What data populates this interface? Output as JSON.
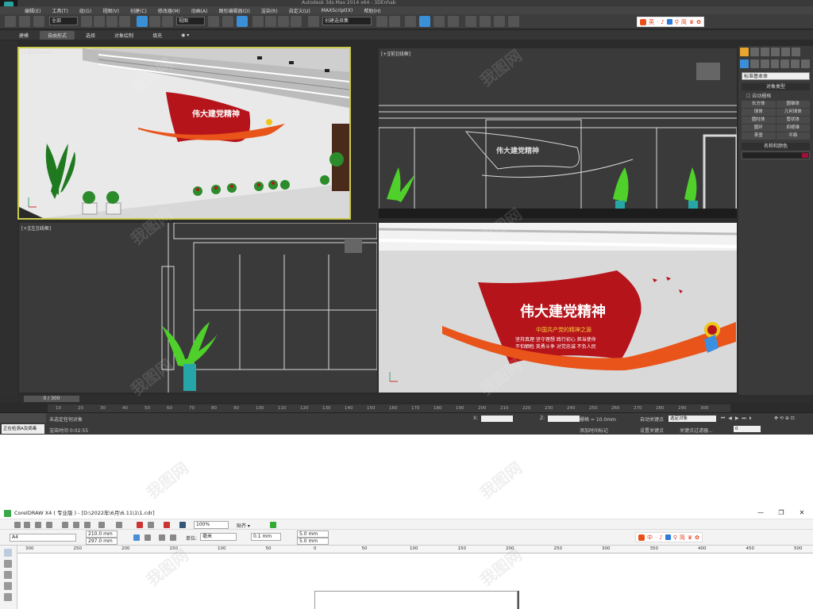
{
  "max": {
    "title": "Autodesk 3ds Max 2014 x64   -   3DEnhab",
    "menu": [
      "编辑(E)",
      "工具(T)",
      "组(G)",
      "视图(V)",
      "创建(C)",
      "修改器(M)",
      "动画(A)",
      "图形编辑器(D)",
      "渲染(R)",
      "自定义(U)",
      "MAXScript(X)",
      "帮助(H)"
    ],
    "toolbar": {
      "filter": "全部",
      "view": "视图",
      "named_selection": "创建选择集"
    },
    "ribbon_tabs": [
      "建模",
      "自由形式",
      "选择",
      "对象绘制",
      "填充"
    ],
    "ribbon_active": 1,
    "viewports": {
      "perspective": "[+][Camera]",
      "front": "[+][前][线框]",
      "left": "[+][左][线框]",
      "camera2": ""
    },
    "sign": {
      "title": "伟大建党精神",
      "subtitle": "中国共产党的精神之源",
      "lines": [
        "坚持真理  坚守理想  践行初心  担当使命",
        "不怕牺牲  英勇斗争  对党忠诚  不负人民"
      ]
    },
    "panel": {
      "category": "标准基本体",
      "section_object_type": "对象类型",
      "autogrid": "自动栅格",
      "objects": [
        "长方体",
        "圆锥体",
        "球体",
        "几何球体",
        "圆柱体",
        "管状体",
        "圆环",
        "四棱锥",
        "茶壶",
        "平面"
      ],
      "section_name_color": "名称和颜色"
    },
    "timeline": {
      "slider": "0 / 300",
      "ticks": [
        "10",
        "20",
        "30",
        "40",
        "50",
        "60",
        "70",
        "80",
        "90",
        "100",
        "110",
        "120",
        "130",
        "140",
        "150",
        "160",
        "170",
        "180",
        "190",
        "200",
        "210",
        "220",
        "230",
        "240",
        "250",
        "260",
        "270",
        "280",
        "290",
        "300"
      ]
    },
    "status": {
      "selected": "未选定任何对象",
      "render_time": "渲染时间 0:02:55",
      "warn": "正在检测A及病毒",
      "x_label": "X:",
      "z_label": "Z:",
      "grid": "栅格 = 10.0mm",
      "autokey": "自动关键点",
      "setkey": "设置关键点",
      "selected_obj": "选定对象",
      "key_filter": "关键点过滤器...",
      "add_time_tag": "添加时间标记",
      "frame": "0"
    },
    "ime": [
      "英",
      "·",
      "♪",
      "⊞",
      "⚲",
      "简",
      "♛",
      "✿"
    ]
  },
  "cdr": {
    "title": "CorelDRAW X4 ( 专业版 ) - [D:\\2022年\\6月\\6.11\\1\\1.cdr]",
    "zoom": "100%",
    "snap": "贴齐 ▾",
    "paper": "A4",
    "width": "210.0 mm",
    "height": "297.0 mm",
    "unit_label": "单位:",
    "unit": "毫米",
    "nudge": "0.1 mm",
    "dup_x": "5.0 mm",
    "dup_y": "5.0 mm",
    "ruler": [
      "300",
      "250",
      "200",
      "150",
      "100",
      "50",
      "0",
      "50",
      "100",
      "150",
      "200",
      "250",
      "300",
      "350",
      "400",
      "450",
      "500"
    ],
    "ime": [
      "中",
      "·",
      "♪",
      "⊞",
      "⚲",
      "简",
      "♛",
      "✿"
    ],
    "window": {
      "min": "—",
      "max": "❐",
      "close": "✕"
    }
  },
  "colors": {
    "sign_red": "#b5141b",
    "sign_orange": "#e8541a",
    "accent_yellow": "#c9c94a",
    "plant_green": "#2ec42e"
  }
}
